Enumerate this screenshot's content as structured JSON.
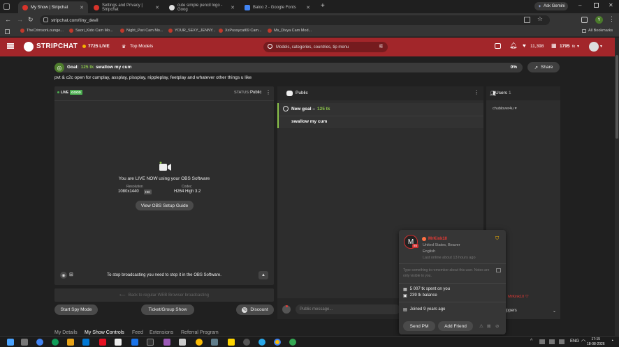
{
  "browser": {
    "tabs": [
      {
        "title": "My Show | Stripchat",
        "active": true,
        "color": "#d8342b"
      },
      {
        "title": "Settings and Privacy | Stripchat",
        "active": false,
        "color": "#d8342b"
      },
      {
        "title": "cute simple pencil logo - Goog",
        "active": false,
        "color": "#e0e0e0"
      },
      {
        "title": "Baloo 2 - Google Fonts",
        "active": false,
        "color": "#4285f4"
      }
    ],
    "ask_gemini": "Ask Gemini",
    "url": "stripchat.com/tiny_devil",
    "profile_letter": "Y",
    "bookmarks": [
      "TheCrimsonLounge...",
      "Saori_Kido Cam Mo...",
      "Night_Pari Cam Mo...",
      "YOUR_SEXY_JENNY...",
      "XxPussycat69 Cam...",
      "Ms_Divya Cam Mod..."
    ],
    "all_bookmarks": "All Bookmarks"
  },
  "site": {
    "logo": "STRIPCHAT",
    "live_count": "7725 LIVE",
    "top_models": "Top Models",
    "search_placeholder": "Models, categories, countries, tip menu",
    "likes": "11,398",
    "tokens": "1795",
    "tokens_unit": "tk"
  },
  "goal": {
    "label": "Goal:",
    "amount": "125 tk",
    "text": "swallow my cum",
    "percent": "0%",
    "progress": 0,
    "share": "Share"
  },
  "topic": "pvt & c2c open for cumplay, assplay, pissplay, nippleplay, feetplay and whatever other things u like",
  "video": {
    "live_badge": "LIVE",
    "quality_badge": "GOOD",
    "status_label": "STATUS:",
    "status_value": "Public",
    "live_now_text": "You are LIVE NOW using your OBS Software",
    "resolution_label": "Resolution",
    "resolution_value": "1080x1440",
    "hd": "HD",
    "codec_label": "Codec",
    "codec_value": "H264 High 3.2",
    "obs_guide": "View OBS Setup Guide",
    "stop_text": "To stop broadcasting you need to stop it in the OBS Software.",
    "back_webrtc": "Back to regular WEB Browser broadcasting"
  },
  "actions": {
    "spy": "Start Spy Mode",
    "ticket": "Ticket/Group Show",
    "discount": "Discount"
  },
  "tabs_bottom": [
    "My Details",
    "My Show Controls",
    "Feed",
    "Extensions",
    "Referral Program"
  ],
  "chat": {
    "title": "Public",
    "new_goal_label": "New goal –",
    "new_goal_amount": "125 tk",
    "goal_text": "swallow my cum",
    "message_placeholder": "Public message..."
  },
  "users": {
    "title": "Users",
    "count": "1",
    "list": [
      {
        "name": "chublover4u"
      }
    ],
    "top_user": "MrKink10",
    "tippers": "Tippers"
  },
  "popup": {
    "avatar_letter": "M",
    "level": "85",
    "name": "MrKink10",
    "location": "United States, Beaver",
    "language": "English",
    "last_online": "Last online about 13 hours ago",
    "note_placeholder": "Type something to remember about this user. Notes are only visible to you.",
    "spent": "5 007 tk spent on you",
    "balance": "239 tk balance",
    "joined": "Joined 9 years ago",
    "send_pm": "Send PM",
    "add_friend": "Add Friend"
  },
  "system": {
    "lang": "ENG",
    "time": "17:15",
    "date": "18-08-2026"
  },
  "colors": {
    "brand_red": "#a2262a",
    "goal_green": "#8bc34a",
    "badge_green": "#4caf50"
  }
}
